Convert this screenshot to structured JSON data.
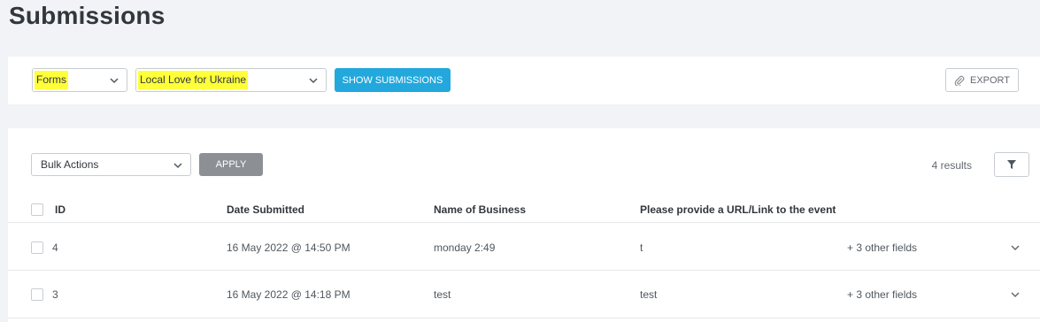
{
  "page": {
    "title": "Submissions"
  },
  "filters": {
    "form_type": "Forms",
    "form": "Local Love for Ukraine",
    "show_button": "SHOW SUBMISSIONS",
    "export_button": "EXPORT",
    "highlight_color": "#ffff3a",
    "primary_color": "#22a8dd"
  },
  "toolbar": {
    "bulk_actions": "Bulk Actions",
    "apply_button": "APPLY",
    "results": "4 results"
  },
  "table": {
    "columns": [
      "ID",
      "Date Submitted",
      "Name of Business",
      "Please provide a URL/Link to the event"
    ],
    "rows": [
      {
        "id": "4",
        "date": "16 May 2022 @ 14:50 PM",
        "name": "monday 2:49",
        "url": "t",
        "more": "+ 3 other fields"
      },
      {
        "id": "3",
        "date": "16 May 2022 @ 14:18 PM",
        "name": "test",
        "url": "test",
        "more": "+ 3 other fields"
      }
    ]
  }
}
